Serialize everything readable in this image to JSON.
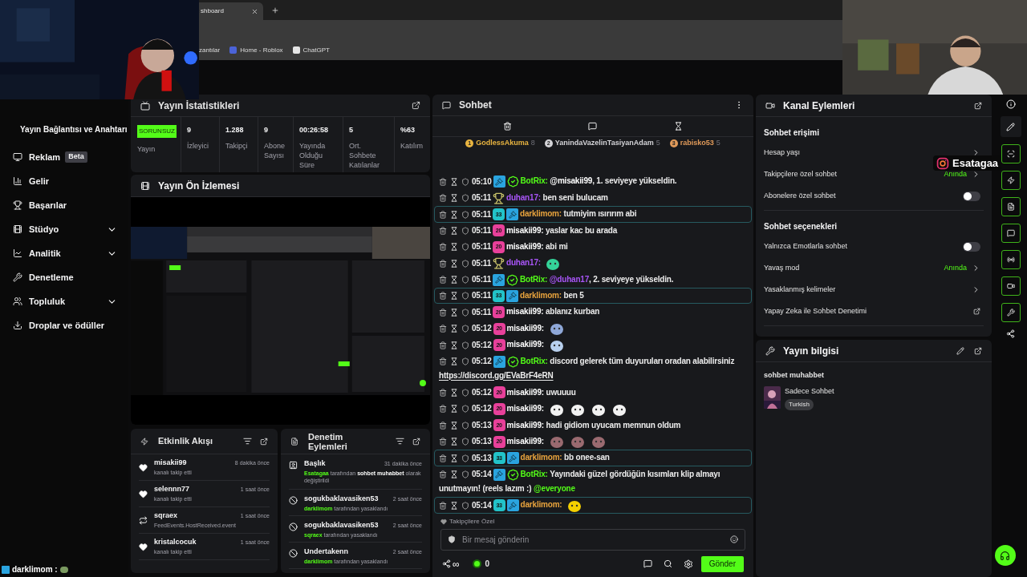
{
  "browser": {
    "tab": {
      "title": "shboard"
    },
    "bookmarks": [
      {
        "label": "zantılar"
      },
      {
        "label": "Home - Roblox"
      },
      {
        "label": "ChatGPT"
      }
    ]
  },
  "overlays": {
    "instagram": {
      "handle": "Esatagaa"
    },
    "chat_ticker": {
      "text": "darklimom :"
    }
  },
  "sidebar": {
    "header": "Yayın Bağlantısı ve Anahtarı",
    "items": [
      {
        "label": "Reklam",
        "badge": "Beta",
        "expandable": false
      },
      {
        "label": "Gelir",
        "expandable": false
      },
      {
        "label": "Başarılar",
        "expandable": false
      },
      {
        "label": "Stüdyo",
        "expandable": true
      },
      {
        "label": "Analitik",
        "expandable": true
      },
      {
        "label": "Denetleme",
        "expandable": false
      },
      {
        "label": "Topluluk",
        "expandable": true
      },
      {
        "label": "Droplar ve ödüller",
        "expandable": false
      }
    ]
  },
  "stats": {
    "title": "Yayın İstatistikleri",
    "status": {
      "badge": "SORUNSUZ",
      "label": "Yayın"
    },
    "items": [
      {
        "value": "9",
        "label": "İzleyici"
      },
      {
        "value": "1.288",
        "label": "Takipçi"
      },
      {
        "value": "9",
        "label": "Abone Sayısı"
      },
      {
        "value": "00:26:58",
        "label": "Yayında Olduğu Süre"
      },
      {
        "value": "5",
        "label": "Ort. Sohbete Katılanlar"
      },
      {
        "value": "%63",
        "label": "Katılım"
      }
    ]
  },
  "preview": {
    "title": "Yayın Ön İzlemesi",
    "kind": "picture"
  },
  "activity": {
    "title": "Etkinlik Akışı",
    "items": [
      {
        "kind": "follow",
        "name": "misakii99",
        "time": "8 dakika önce",
        "text": "kanalı takip etti"
      },
      {
        "kind": "follow",
        "name": "selennn77",
        "time": "1 saat önce",
        "text": "kanalı takip etti"
      },
      {
        "kind": "host",
        "name": "sqraex",
        "time": "1 saat önce",
        "text": "FeedEvents.HostReceived.event"
      },
      {
        "kind": "follow",
        "name": "kristalcocuk",
        "time": "1 saat önce",
        "text": "kanalı takip etti"
      }
    ]
  },
  "moderation": {
    "title": "Denetim Eylemleri",
    "items": [
      {
        "kind": "title",
        "name": "Başlık",
        "time": "31 dakika önce",
        "actor": "Esatagaa",
        "text": "tarafından **sohbet muhabbet** olarak değiştirildi"
      },
      {
        "kind": "ban",
        "name": "sogukbaklavasiken53",
        "time": "2 saat önce",
        "actor": "darklimom",
        "text": "tarafından yasaklandı"
      },
      {
        "kind": "ban",
        "name": "sogukbaklavasiken53",
        "time": "2 saat önce",
        "actor": "sqraex",
        "text": "tarafından yasaklandı"
      },
      {
        "kind": "ban",
        "name": "Undertakenn",
        "time": "2 saat önce",
        "actor": "darklimom",
        "text": "tarafından yasaklandı"
      }
    ]
  },
  "chat": {
    "title": "Sohbet",
    "top_chatters": [
      {
        "rank": "1",
        "name": "GodlessAkuma",
        "count": "8",
        "color": "#e8b440"
      },
      {
        "rank": "2",
        "name": "YanindaVazelinTasiyanAdam",
        "count": "5",
        "color": "#d4d4d8"
      },
      {
        "rank": "3",
        "name": "rabisko53",
        "count": "5",
        "color": "#e09a5a"
      }
    ],
    "messages": [
      {
        "time": "05:10",
        "badges": [
          {
            "kind": "mod"
          },
          {
            "kind": "verified"
          }
        ],
        "user": "BotRix:",
        "color": "#53fc18",
        "highlighted": false,
        "segments": [
          {
            "kind": "mention",
            "text": "@misakii99",
            "color": "#ffffff"
          },
          {
            "kind": "text",
            "text": ", 1. seviyeye yükseldin."
          }
        ]
      },
      {
        "time": "05:11",
        "badges": [
          {
            "kind": "trophy"
          }
        ],
        "user": "duhan17:",
        "color": "#a855f7",
        "highlighted": false,
        "segments": [
          {
            "kind": "text",
            "text": "ben seni bulucam"
          }
        ]
      },
      {
        "time": "05:11",
        "badges": [
          {
            "kind": "sub",
            "text": "33",
            "color": "#22c3c9"
          },
          {
            "kind": "mod"
          }
        ],
        "user": "darklimom:",
        "color": "#e8a33d",
        "highlighted": true,
        "segments": [
          {
            "kind": "text",
            "text": "tutmiyim ısırırım abi"
          }
        ]
      },
      {
        "time": "05:11",
        "badges": [
          {
            "kind": "sub",
            "text": "20",
            "color": "#e8409a"
          }
        ],
        "user": "misakii99:",
        "color": "#ffffff",
        "highlighted": false,
        "segments": [
          {
            "kind": "text",
            "text": "yaslar kac bu arada"
          }
        ]
      },
      {
        "time": "05:11",
        "badges": [
          {
            "kind": "sub",
            "text": "20",
            "color": "#e8409a"
          }
        ],
        "user": "misakii99:",
        "color": "#ffffff",
        "highlighted": false,
        "segments": [
          {
            "kind": "text",
            "text": "abi mi"
          }
        ]
      },
      {
        "time": "05:11",
        "badges": [
          {
            "kind": "trophy"
          }
        ],
        "user": "duhan17:",
        "color": "#a855f7",
        "highlighted": false,
        "segments": [
          {
            "kind": "emote",
            "color": "#34d399"
          }
        ]
      },
      {
        "time": "05:11",
        "badges": [
          {
            "kind": "mod"
          },
          {
            "kind": "verified"
          }
        ],
        "user": "BotRix:",
        "color": "#53fc18",
        "highlighted": false,
        "segments": [
          {
            "kind": "mention",
            "text": "@duhan17",
            "color": "#a855f7"
          },
          {
            "kind": "text",
            "text": ", 2. seviyeye yükseldin."
          }
        ]
      },
      {
        "time": "05:11",
        "badges": [
          {
            "kind": "sub",
            "text": "33",
            "color": "#22c3c9"
          },
          {
            "kind": "mod"
          }
        ],
        "user": "darklimom:",
        "color": "#e8a33d",
        "highlighted": true,
        "segments": [
          {
            "kind": "text",
            "text": "ben 5"
          }
        ]
      },
      {
        "time": "05:11",
        "badges": [
          {
            "kind": "sub",
            "text": "20",
            "color": "#e8409a"
          }
        ],
        "user": "misakii99:",
        "color": "#ffffff",
        "highlighted": false,
        "segments": [
          {
            "kind": "text",
            "text": "ablanız kurban"
          }
        ]
      },
      {
        "time": "05:12",
        "badges": [
          {
            "kind": "sub",
            "text": "20",
            "color": "#e8409a"
          }
        ],
        "user": "misakii99:",
        "color": "#ffffff",
        "highlighted": false,
        "segments": [
          {
            "kind": "emote",
            "color": "#8fa8d8"
          }
        ]
      },
      {
        "time": "05:12",
        "badges": [
          {
            "kind": "sub",
            "text": "20",
            "color": "#e8409a"
          }
        ],
        "user": "misakii99:",
        "color": "#ffffff",
        "highlighted": false,
        "segments": [
          {
            "kind": "emote",
            "color": "#b8d0ee"
          }
        ]
      },
      {
        "time": "05:12",
        "badges": [
          {
            "kind": "mod"
          },
          {
            "kind": "verified"
          }
        ],
        "user": "BotRix:",
        "color": "#53fc18",
        "highlighted": false,
        "segments": [
          {
            "kind": "text",
            "text": "discord gelerek tüm duyuruları oradan alabilirsiniz"
          },
          {
            "kind": "link",
            "text": "https://discord.gg/EVaBrF4eRN"
          }
        ]
      },
      {
        "time": "05:12",
        "badges": [
          {
            "kind": "sub",
            "text": "20",
            "color": "#e8409a"
          }
        ],
        "user": "misakii99:",
        "color": "#ffffff",
        "highlighted": false,
        "segments": [
          {
            "kind": "text",
            "text": "uwuuuu"
          }
        ]
      },
      {
        "time": "05:12",
        "badges": [
          {
            "kind": "sub",
            "text": "20",
            "color": "#e8409a"
          }
        ],
        "user": "misakii99:",
        "color": "#ffffff",
        "highlighted": false,
        "segments": [
          {
            "kind": "emote",
            "color": "#f2f2f2"
          },
          {
            "kind": "emote",
            "color": "#f2f2f2"
          },
          {
            "kind": "emote",
            "color": "#f2f2f2"
          },
          {
            "kind": "emote",
            "color": "#f2f2f2"
          }
        ]
      },
      {
        "time": "05:13",
        "badges": [
          {
            "kind": "sub",
            "text": "20",
            "color": "#e8409a"
          }
        ],
        "user": "misakii99:",
        "color": "#ffffff",
        "highlighted": false,
        "segments": [
          {
            "kind": "text",
            "text": "hadi gidiom uyucam memnun oldum"
          }
        ]
      },
      {
        "time": "05:13",
        "badges": [
          {
            "kind": "sub",
            "text": "20",
            "color": "#e8409a"
          }
        ],
        "user": "misakii99:",
        "color": "#ffffff",
        "highlighted": false,
        "segments": [
          {
            "kind": "emote",
            "color": "#9a6a70"
          },
          {
            "kind": "emote",
            "color": "#9a6a70"
          },
          {
            "kind": "emote",
            "color": "#9a6a70"
          }
        ]
      },
      {
        "time": "05:13",
        "badges": [
          {
            "kind": "sub",
            "text": "33",
            "color": "#22c3c9"
          },
          {
            "kind": "mod"
          }
        ],
        "user": "darklimom:",
        "color": "#e8a33d",
        "highlighted": true,
        "segments": [
          {
            "kind": "text",
            "text": "bb onee-san"
          }
        ]
      },
      {
        "time": "05:14",
        "badges": [
          {
            "kind": "mod"
          },
          {
            "kind": "verified"
          }
        ],
        "user": "BotRix:",
        "color": "#53fc18",
        "highlighted": false,
        "segments": [
          {
            "kind": "text",
            "text": "Yayındaki güzel gördüğün kısımları klip almayı"
          },
          {
            "kind": "text",
            "text": "unutmayın! (reels lazım :)"
          },
          {
            "kind": "mention",
            "text": "@everyone",
            "color": "#53fc18"
          }
        ]
      },
      {
        "time": "05:14",
        "badges": [
          {
            "kind": "sub",
            "text": "33",
            "color": "#22c3c9"
          },
          {
            "kind": "mod"
          }
        ],
        "user": "darklimom:",
        "color": "#e8a33d",
        "highlighted": true,
        "segments": [
          {
            "kind": "emote",
            "color": "#f5d000"
          }
        ]
      }
    ],
    "notice": "Takipçilere Özel",
    "input": {
      "placeholder": "Bir mesaj gönderin"
    },
    "footer": {
      "infinity": "∞",
      "points": "0",
      "send": "Gönder"
    }
  },
  "channel": {
    "title": "Kanal Eylemleri",
    "sections": [
      {
        "title": "Sohbet erişimi",
        "rows": [
          {
            "kind": "link",
            "label": "Hesap yaşı"
          },
          {
            "kind": "link",
            "label": "Takipçilere özel sohbet",
            "value": "Anında"
          },
          {
            "kind": "toggle",
            "label": "Abonelere özel sohbet",
            "on": false
          }
        ]
      },
      {
        "title": "Sohbet seçenekleri",
        "rows": [
          {
            "kind": "toggle",
            "label": "Yalnızca Emotlarla sohbet",
            "on": false
          },
          {
            "kind": "link",
            "label": "Yavaş mod",
            "value": "Anında"
          },
          {
            "kind": "link",
            "label": "Yasaklanmış kelimeler"
          },
          {
            "kind": "external",
            "label": "Yapay Zeka ile Sohbet Denetimi"
          }
        ]
      }
    ]
  },
  "stream_info": {
    "title": "Yayın bilgisi",
    "stream_title": "sohbet muhabbet",
    "category": "Sadece Sohbet",
    "tags": [
      "Turkish"
    ]
  }
}
